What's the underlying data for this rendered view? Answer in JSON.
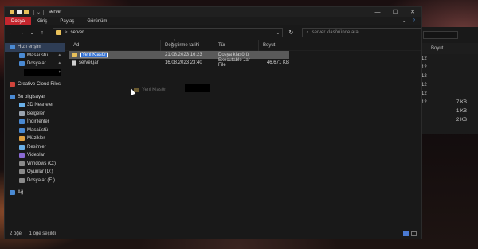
{
  "window": {
    "title": "server",
    "controls": {
      "minimize": "—",
      "maximize": "☐",
      "close": "✕"
    }
  },
  "ribbon": {
    "tabs": [
      "Dosya",
      "Giriş",
      "Paylaş",
      "Görünüm"
    ],
    "active_tab": "Dosya",
    "expand": "⌄",
    "help": "?"
  },
  "navbar": {
    "back": "←",
    "forward": "→",
    "recent": "⌄",
    "up": "↑",
    "path_separator": ">",
    "path": "server",
    "refresh": "↻",
    "search_placeholder": "server klasöründe ara"
  },
  "sidebar": {
    "items": [
      {
        "label": "Hızlı erişim",
        "icon": "star-icon",
        "level": "top",
        "selected": true,
        "pinned": false
      },
      {
        "label": "Masaüstü",
        "icon": "desktop-icon",
        "level": "sub",
        "pinned": true
      },
      {
        "label": "Dosyalar",
        "icon": "download-icon",
        "level": "sub",
        "pinned": true
      },
      {
        "label": "",
        "icon": "",
        "level": "sub",
        "redacted": true,
        "pinned": true
      },
      {
        "label": "Creative Cloud Files",
        "icon": "cloud-icon",
        "level": "top"
      },
      {
        "label": "Bu bilgisayar",
        "icon": "computer-icon",
        "level": "top"
      },
      {
        "label": "3D Nesneler",
        "icon": "cube-icon",
        "level": "sub"
      },
      {
        "label": "Belgeler",
        "icon": "document-icon",
        "level": "sub"
      },
      {
        "label": "İndirilenler",
        "icon": "download-icon",
        "level": "sub"
      },
      {
        "label": "Masaüstü",
        "icon": "desktop-icon",
        "level": "sub"
      },
      {
        "label": "Müzikler",
        "icon": "music-icon",
        "level": "sub"
      },
      {
        "label": "Resimler",
        "icon": "image-icon",
        "level": "sub"
      },
      {
        "label": "Videolar",
        "icon": "video-icon",
        "level": "sub"
      },
      {
        "label": "Windows (C:)",
        "icon": "drive-icon",
        "level": "sub"
      },
      {
        "label": "Oyunlar (D:)",
        "icon": "drive-icon",
        "level": "sub"
      },
      {
        "label": "Dosyalar (E:)",
        "icon": "drive-icon",
        "level": "sub"
      },
      {
        "label": "Ağ",
        "icon": "network-icon",
        "level": "top"
      }
    ]
  },
  "columns": {
    "name": "Ad",
    "date": "Değiştirme tarihi",
    "type": "Tür",
    "size": "Boyut"
  },
  "files": [
    {
      "name": "Yeni Klasör",
      "date": "21.08.2023 16:23",
      "type": "Dosya klasörü",
      "size": "",
      "kind": "folder",
      "renaming": true
    },
    {
      "name": "server.jar",
      "date": "16.08.2023 23:40",
      "type": "Executable Jar File",
      "size": "46.671 KB",
      "kind": "jar"
    }
  ],
  "drag_ghost": {
    "label": "Yeni Klasör"
  },
  "status": {
    "item_count": "2 öğe",
    "selected": "1 öğe seçildi"
  },
  "background_window": {
    "header": "Boyut",
    "rows": [
      {
        "left": "12",
        "right": ""
      },
      {
        "left": "12",
        "right": ""
      },
      {
        "left": "12",
        "right": ""
      },
      {
        "left": "12",
        "right": ""
      },
      {
        "left": "12",
        "right": ""
      },
      {
        "left": "12",
        "right": "7 KB"
      },
      {
        "left": "",
        "right": "1 KB"
      },
      {
        "left": "",
        "right": "2 KB"
      }
    ]
  },
  "colors": {
    "accent": "#c4262e",
    "folder": "#e8c05a",
    "selection": "#5a5a5a",
    "nav_selected": "#2e3d55"
  }
}
